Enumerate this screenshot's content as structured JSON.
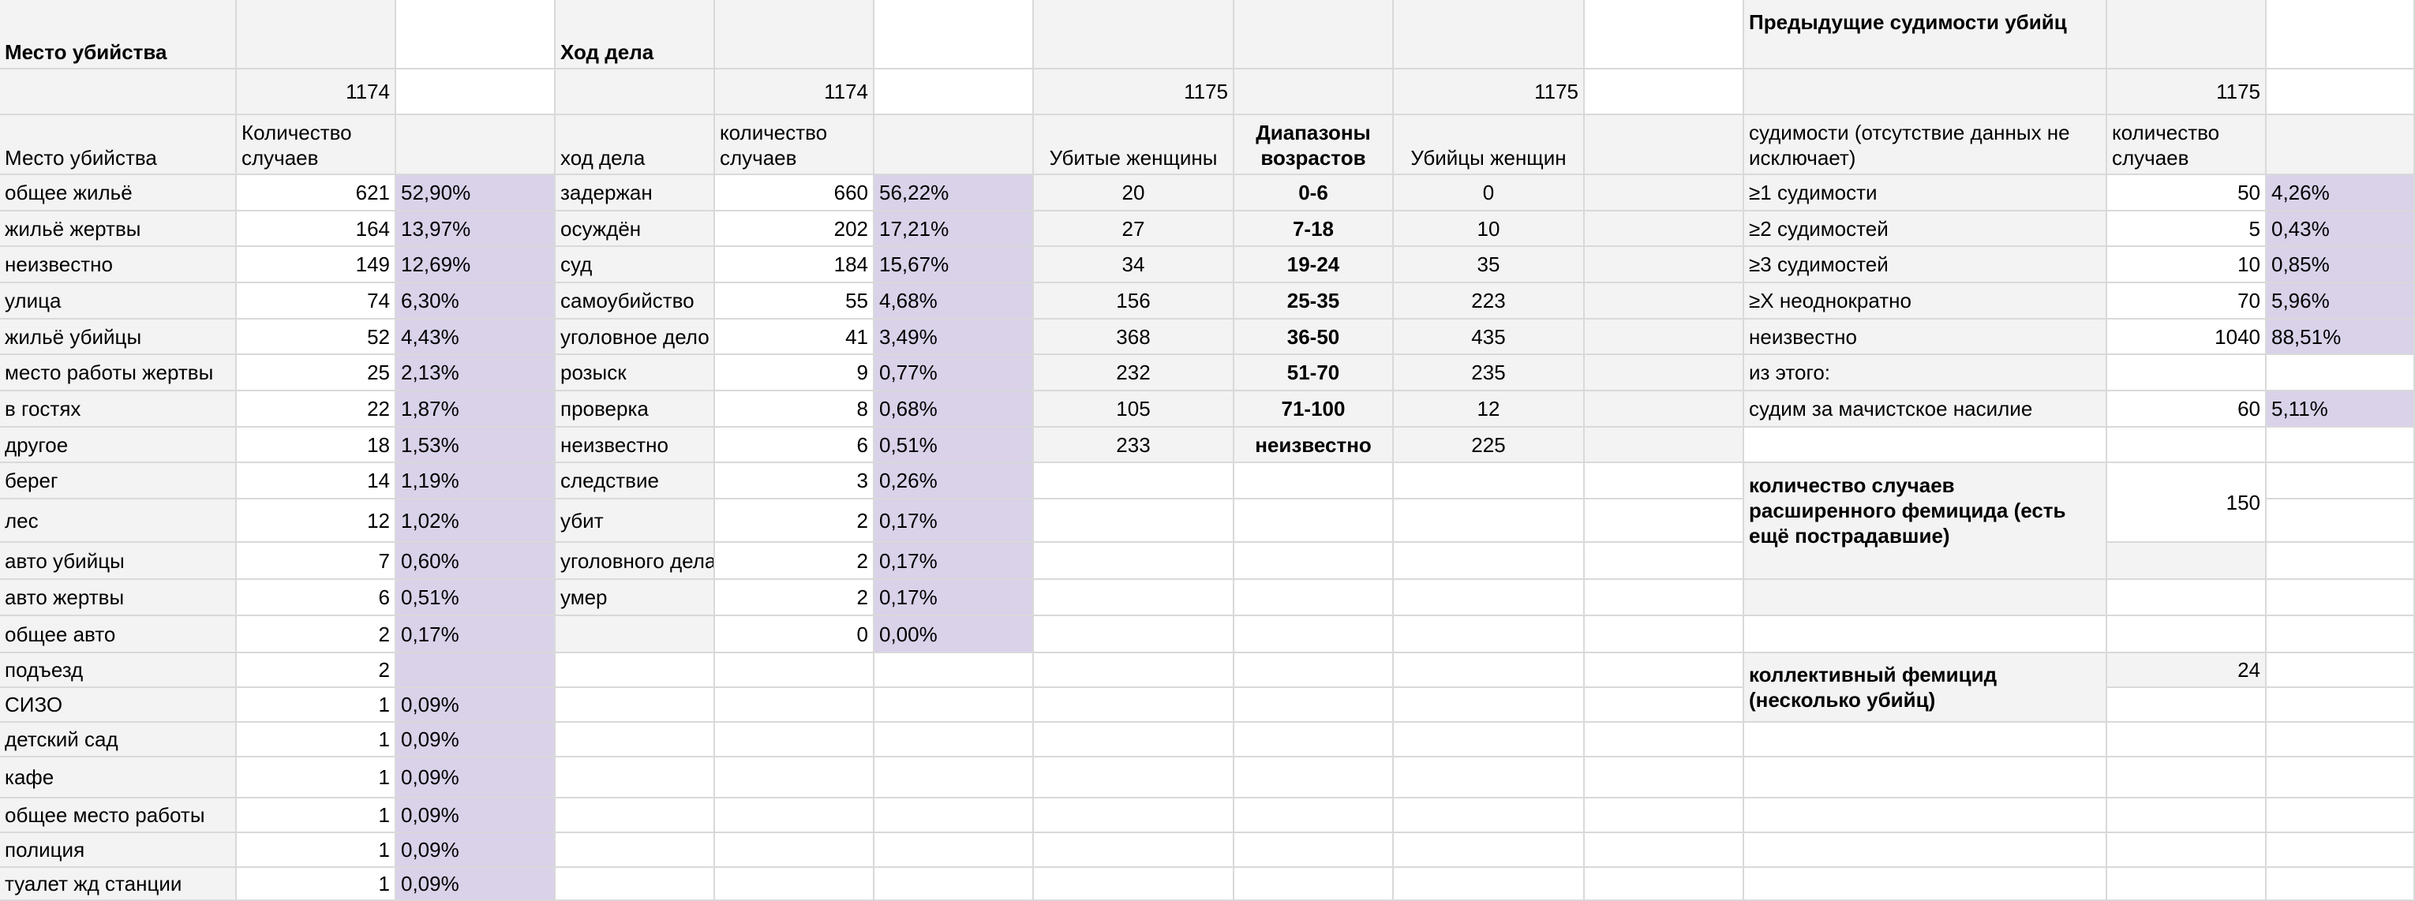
{
  "murder_place": {
    "title": "Место убийства",
    "total": "1174",
    "col_label": "Место убийства",
    "col_count": "Количество случаев",
    "rows": [
      {
        "label": "общее жильё",
        "count": "621",
        "pct": "52,90%"
      },
      {
        "label": "жильё жертвы",
        "count": "164",
        "pct": "13,97%"
      },
      {
        "label": "неизвестно",
        "count": "149",
        "pct": "12,69%"
      },
      {
        "label": "улица",
        "count": "74",
        "pct": "6,30%"
      },
      {
        "label": "жильё убийцы",
        "count": "52",
        "pct": "4,43%"
      },
      {
        "label": "место работы жертвы",
        "count": "25",
        "pct": "2,13%"
      },
      {
        "label": "в гостях",
        "count": "22",
        "pct": "1,87%"
      },
      {
        "label": "другое",
        "count": "18",
        "pct": "1,53%"
      },
      {
        "label": "берег",
        "count": "14",
        "pct": "1,19%"
      },
      {
        "label": "лес",
        "count": "12",
        "pct": "1,02%"
      },
      {
        "label": "авто убийцы",
        "count": "7",
        "pct": "0,60%"
      },
      {
        "label": "авто жертвы",
        "count": "6",
        "pct": "0,51%"
      },
      {
        "label": "общее авто",
        "count": "2",
        "pct": "0,17%"
      },
      {
        "label": "подъезд",
        "count": "2",
        "pct": ""
      },
      {
        "label": "СИЗО",
        "count": "1",
        "pct": "0,09%"
      },
      {
        "label": "детский сад",
        "count": "1",
        "pct": "0,09%"
      },
      {
        "label": "кафе",
        "count": "1",
        "pct": "0,09%"
      },
      {
        "label": "общее место работы",
        "count": "1",
        "pct": "0,09%"
      },
      {
        "label": "полиция",
        "count": "1",
        "pct": "0,09%"
      },
      {
        "label": "туалет жд станции",
        "count": "1",
        "pct": "0,09%"
      }
    ]
  },
  "case_progress": {
    "title": "Ход дела",
    "total": "1174",
    "col_label": "ход дела",
    "col_count": "количество случаев",
    "rows": [
      {
        "label": "задержан",
        "count": "660",
        "pct": "56,22%"
      },
      {
        "label": "осуждён",
        "count": "202",
        "pct": "17,21%"
      },
      {
        "label": "суд",
        "count": "184",
        "pct": "15,67%"
      },
      {
        "label": "самоубийство",
        "count": "55",
        "pct": "4,68%"
      },
      {
        "label": "уголовное дело",
        "count": "41",
        "pct": "3,49%"
      },
      {
        "label": "розыск",
        "count": "9",
        "pct": "0,77%"
      },
      {
        "label": "проверка",
        "count": "8",
        "pct": "0,68%"
      },
      {
        "label": "неизвестно",
        "count": "6",
        "pct": "0,51%"
      },
      {
        "label": "следствие",
        "count": "3",
        "pct": "0,26%"
      },
      {
        "label": "убит",
        "count": "2",
        "pct": "0,17%"
      },
      {
        "label": "уголовного дела",
        "count": "2",
        "pct": "0,17%"
      },
      {
        "label": "умер",
        "count": "2",
        "pct": "0,17%"
      },
      {
        "label": "",
        "count": "0",
        "pct": "0,00%"
      }
    ]
  },
  "ages": {
    "total_victims": "1175",
    "total_killers": "1175",
    "col_victims": "Убитые женщины",
    "col_range": "Диапазоны возрастов",
    "col_killers": "Убийцы женщин",
    "rows": [
      {
        "victims": "20",
        "range": "0-6",
        "killers": "0"
      },
      {
        "victims": "27",
        "range": "7-18",
        "killers": "10"
      },
      {
        "victims": "34",
        "range": "19-24",
        "killers": "35"
      },
      {
        "victims": "156",
        "range": "25-35",
        "killers": "223"
      },
      {
        "victims": "368",
        "range": "36-50",
        "killers": "435"
      },
      {
        "victims": "232",
        "range": "51-70",
        "killers": "235"
      },
      {
        "victims": "105",
        "range": "71-100",
        "killers": "12"
      },
      {
        "victims": "233",
        "range": "неизвестно",
        "killers": "225"
      }
    ]
  },
  "convictions": {
    "title": "Предыдущие судимости убийц",
    "total": "1175",
    "col_label": "судимости (отсутствие данных не исключает)",
    "col_count": "количество случаев",
    "rows": [
      {
        "label": "≥1 судимости",
        "count": "50",
        "pct": "4,26%"
      },
      {
        "label": "≥2 судимостей",
        "count": "5",
        "pct": "0,43%"
      },
      {
        "label": "≥3 судимостей",
        "count": "10",
        "pct": "0,85%"
      },
      {
        "label": "≥X неоднократно",
        "count": "70",
        "pct": "5,96%"
      },
      {
        "label": "неизвестно",
        "count": "1040",
        "pct": "88,51%"
      },
      {
        "label": "из этого:",
        "count": "",
        "pct": ""
      },
      {
        "label": "судим за мачистское насилие",
        "count": "60",
        "pct": "5,11%"
      }
    ],
    "extended_label": "количество случаев расширенного фемицида (есть ещё пострадавшие)",
    "extended_value": "150",
    "collective_label": "коллективный фемицид (несколько убийц)",
    "collective_value": "24"
  }
}
